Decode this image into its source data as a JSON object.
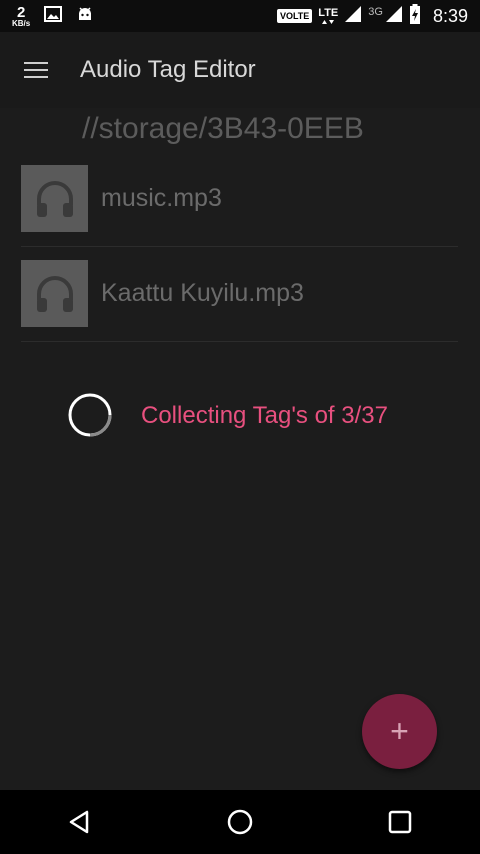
{
  "status_bar": {
    "net_speed_value": "2",
    "net_speed_unit": "KB/s",
    "volte": "VOLTE",
    "lte": "LTE",
    "network_3g": "3G",
    "time": "8:39",
    "icons": [
      "image-icon",
      "android-icon",
      "signal-icon",
      "signal-icon",
      "battery-icon"
    ]
  },
  "toolbar": {
    "title": "Audio Tag Editor"
  },
  "path": "//storage/3B43-0EEB",
  "files": [
    {
      "name": "music.mp3",
      "icon": "headphones-icon"
    },
    {
      "name": "Kaattu Kuyilu.mp3",
      "icon": "headphones-icon"
    }
  ],
  "loading": {
    "text": "Collecting Tag's of 3/37"
  },
  "fab": {
    "label": "+"
  },
  "colors": {
    "accent": "#e8507f",
    "fab": "#7a1f3f",
    "background": "#1c1c1c"
  }
}
